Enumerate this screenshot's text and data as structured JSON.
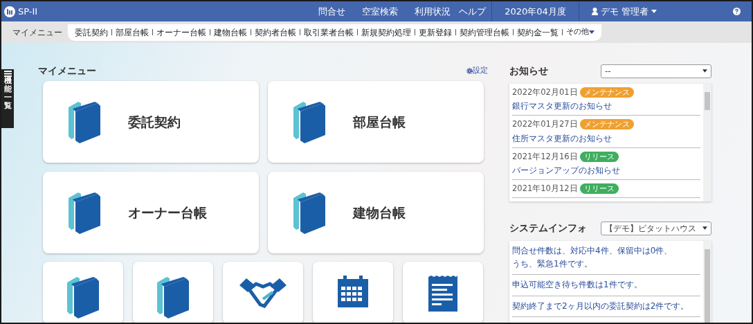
{
  "app": {
    "title": "SP-II"
  },
  "topnav": {
    "links": [
      "問合せ",
      "空室検索",
      "利用状況",
      "ヘルプ"
    ],
    "month": "2020年04月度",
    "user": "デモ 管理者"
  },
  "submenu": {
    "label": "マイメニュー",
    "items": [
      "委託契約",
      "部屋台帳",
      "オーナー台帳",
      "建物台帳",
      "契約者台帳",
      "取引業者台帳",
      "新規契約処理",
      "更新登録",
      "契約管理台帳",
      "契約金一覧"
    ],
    "more": "その他"
  },
  "side_tab": {
    "label": "機能一覧"
  },
  "my_menu": {
    "title": "マイメニュー",
    "settings": "設定",
    "large_cards": [
      {
        "label": "委託契約",
        "kind": "book"
      },
      {
        "label": "部屋台帳",
        "kind": "book"
      },
      {
        "label": "オーナー台帳",
        "kind": "book"
      },
      {
        "label": "建物台帳",
        "kind": "book"
      }
    ],
    "small_cards": [
      {
        "kind": "book"
      },
      {
        "kind": "book"
      },
      {
        "kind": "handshake"
      },
      {
        "kind": "calendar"
      },
      {
        "kind": "document"
      }
    ]
  },
  "news": {
    "title": "お知らせ",
    "filter": "--",
    "items": [
      {
        "date": "2022年02月01日",
        "tag": "メンテナンス",
        "color": "#f0a030",
        "title": "銀行マスタ更新のお知らせ"
      },
      {
        "date": "2022年01月27日",
        "tag": "メンテナンス",
        "color": "#f0a030",
        "title": "住所マスタ更新のお知らせ"
      },
      {
        "date": "2021年12月16日",
        "tag": "リリース",
        "color": "#3fae5e",
        "title": "バージョンアップのお知らせ"
      },
      {
        "date": "2021年10月12日",
        "tag": "リリース",
        "color": "#3fae5e"
      }
    ]
  },
  "system_info": {
    "title": "システムインフォ",
    "filter": "【デモ】ピタットハウス",
    "items": [
      {
        "lines": [
          "問合せ件数は、対応中4件、保留中は0件、",
          "うち、緊急1件です。"
        ]
      },
      {
        "lines": [
          "申込可能空き待ち件数は1件です。"
        ]
      },
      {
        "lines": [
          "契約終了まで2ヶ月以内の委託契約は2件です。"
        ]
      }
    ]
  }
}
